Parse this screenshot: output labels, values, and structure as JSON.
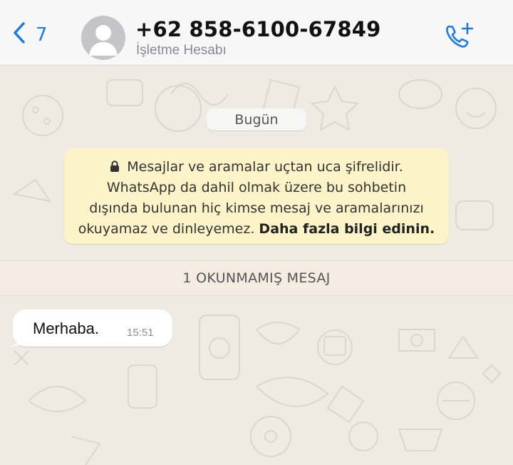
{
  "header": {
    "back_count": "7",
    "contact_name": "+62 858-6100-67849",
    "contact_subtitle": "İşletme Hesabı"
  },
  "icons": {
    "back": "chevron-left-icon",
    "avatar": "person-avatar-icon",
    "call": "phone-add-icon",
    "lock": "lock-icon"
  },
  "chat": {
    "date_label": "Bugün",
    "encryption_notice": {
      "line1": "Mesajlar ve aramalar uçtan uca şifrelidir.",
      "line2": "WhatsApp da dahil olmak üzere bu sohbetin",
      "line3": "dışında bulunan hiç kimse mesaj ve aramalarınızı",
      "line4_start": "okuyamaz ve dinleyemez.",
      "learn_more": "Daha fazla bilgi edinin."
    },
    "unread_banner": "1 OKUNMAMIŞ MESAJ",
    "messages": [
      {
        "text": "Merhaba.",
        "time": "15:51",
        "direction": "incoming"
      }
    ]
  },
  "colors": {
    "accent": "#1f7ae0",
    "chat_background": "#efeae2",
    "notice_background": "#fcf4c8",
    "bubble_background": "#ffffff"
  }
}
